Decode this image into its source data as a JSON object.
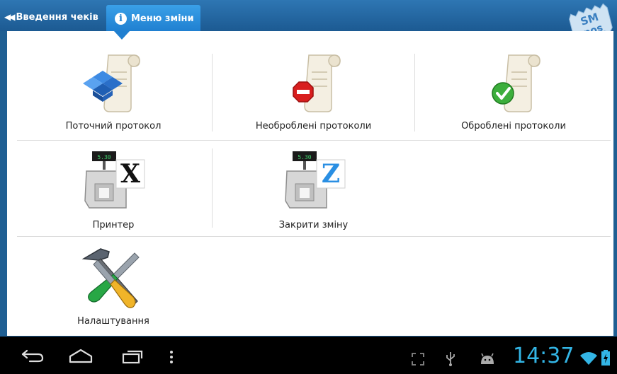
{
  "header": {
    "back_tab_label": "Введення чеків",
    "active_tab_label": "Меню зміни",
    "logo_text_top": "SM",
    "logo_text_bottom": "pos"
  },
  "tiles": [
    {
      "label": "Поточний протокол",
      "icon": "scroll-dropbox-icon"
    },
    {
      "label": "Необроблені протоколи",
      "icon": "scroll-stop-icon"
    },
    {
      "label": "Оброблені протоколи",
      "icon": "scroll-check-icon"
    },
    {
      "label": "Принтер",
      "icon": "printer-x-report-icon",
      "badge": "X",
      "display": "5.30"
    },
    {
      "label": "Закрити зміну",
      "icon": "printer-z-report-icon",
      "badge": "Z",
      "display": "5.30"
    },
    {
      "label": "Налаштування",
      "icon": "hammer-screwdriver-icon"
    }
  ],
  "status_bar": {
    "time": "14:37",
    "accent_color": "#33b5e5"
  },
  "colors": {
    "header_blue": "#1c5a92",
    "active_tab_blue": "#1f7fd0"
  }
}
